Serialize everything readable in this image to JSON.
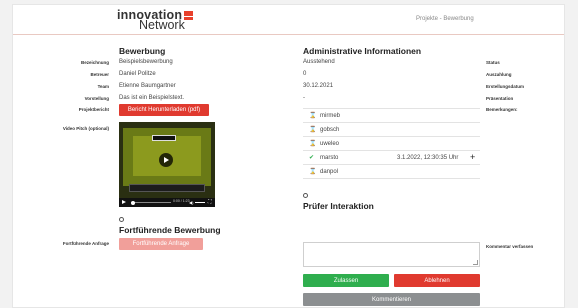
{
  "header": {
    "logo_line1": "innovation",
    "logo_line2": "Network",
    "breadcrumb": "Projekte - Bewerbung"
  },
  "bewerbung": {
    "title": "Bewerbung",
    "fields": [
      {
        "label": "Bezeichnung",
        "value": "Beispielsbewerbung"
      },
      {
        "label": "Betreuer",
        "value": "Daniel Politze"
      },
      {
        "label": "Team",
        "value": "Etienne Baumgartner"
      },
      {
        "label": "Vorstellung",
        "value": "Das ist ein Beispielstext."
      }
    ],
    "projektbericht_label": "Projektbericht",
    "download_button": "Bericht Herunterladen (pdf)",
    "video_label": "Video Pitch (optional)",
    "video_time": "0:00 / 1:23"
  },
  "admin": {
    "title": "Administrative Informationen",
    "values": [
      "Ausstehend",
      "0",
      "30.12.2021",
      "-"
    ],
    "labels": [
      "Status",
      "Auszahlung",
      "Erstellungsdatum",
      "Präsentation",
      "Bemerkungen:"
    ]
  },
  "reviewers": [
    {
      "icon": "hourglass",
      "name": "mirmeb",
      "date": ""
    },
    {
      "icon": "hourglass",
      "name": "gobsch",
      "date": ""
    },
    {
      "icon": "hourglass",
      "name": "uweleo",
      "date": ""
    },
    {
      "icon": "check",
      "name": "marsto",
      "date": "3.1.2022, 12:30:35 Uhr"
    },
    {
      "icon": "hourglass",
      "name": "danpol",
      "date": ""
    }
  ],
  "fortfuehrend": {
    "title": "Fortführende Bewerbung",
    "label": "Fortführende Anfrage",
    "button": "Fortführende Anfrage"
  },
  "pruefer": {
    "title": "Prüfer Interaktion",
    "comment_label": "Kommentar verfassen",
    "comment_value": "",
    "accept": "Zulassen",
    "reject": "Ablehnen",
    "comment_button": "Kommentieren"
  },
  "colors": {
    "accent_red": "#e03a2f",
    "disabled_red": "#f19f9a",
    "green": "#2fae4e",
    "gray": "#8c8f91"
  }
}
